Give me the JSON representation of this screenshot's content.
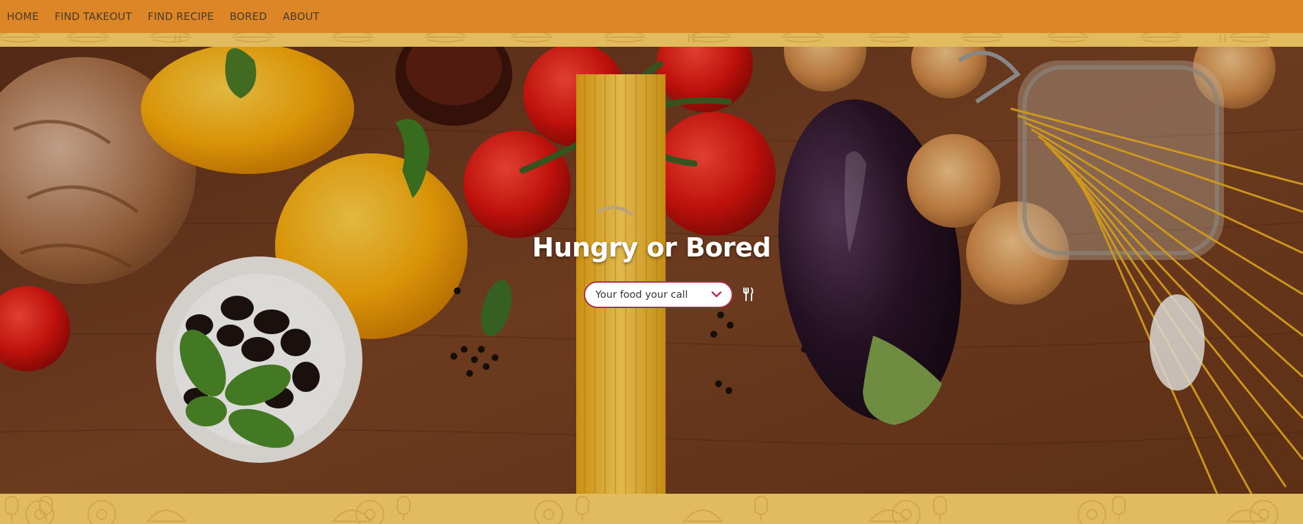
{
  "nav": {
    "items": [
      {
        "label": "HOME"
      },
      {
        "label": "FIND TAKEOUT"
      },
      {
        "label": "FIND RECIPE"
      },
      {
        "label": "BORED"
      },
      {
        "label": "ABOUT"
      }
    ]
  },
  "hero": {
    "title": "Hungry or Bored",
    "select": {
      "value": "Your food your call"
    },
    "icons": {
      "dropdown": "chevron-down-icon",
      "action": "utensils-icon"
    }
  },
  "colors": {
    "nav_bg": "#dc8628",
    "pattern_bg": "#e2bb5f",
    "pattern_line": "#d3a64a",
    "select_border": "#b02a4a",
    "chevron": "#c0284a",
    "title": "#ffffff"
  }
}
